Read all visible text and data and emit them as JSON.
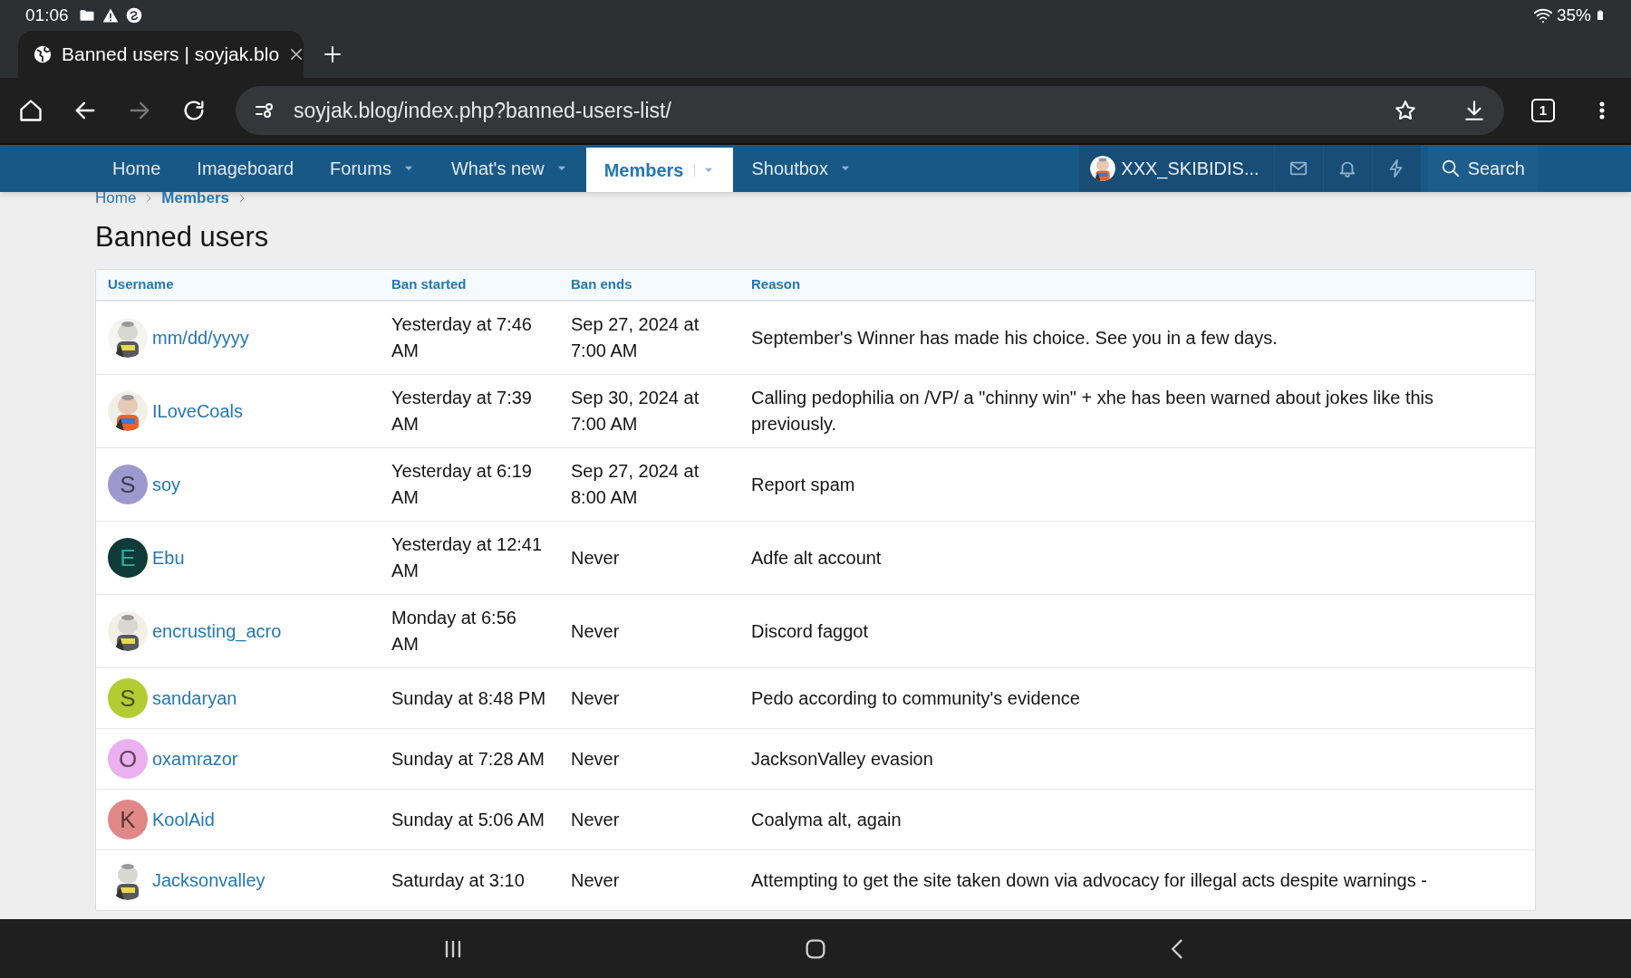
{
  "status_bar": {
    "time": "01:06",
    "battery": "35%"
  },
  "browser": {
    "tab_title": "Banned users | soyjak.blo",
    "url": "soyjak.blog/index.php?banned-users-list/",
    "tab_count": "1"
  },
  "nav": {
    "items": [
      {
        "label": "Home",
        "selected": false,
        "dropdown": false
      },
      {
        "label": "Imageboard",
        "selected": false,
        "dropdown": false
      },
      {
        "label": "Forums",
        "selected": false,
        "dropdown": true
      },
      {
        "label": "What's new",
        "selected": false,
        "dropdown": true
      },
      {
        "label": "Members",
        "selected": true,
        "dropdown": true
      },
      {
        "label": "Shoutbox",
        "selected": false,
        "dropdown": true
      }
    ],
    "user": "XXX_SKIBIDIS...",
    "search": "Search"
  },
  "breadcrumb": [
    "Home",
    "Members"
  ],
  "title": "Banned users",
  "table": {
    "columns": [
      "Username",
      "Ban started",
      "Ban ends",
      "Reason"
    ],
    "rows": [
      {
        "username": "mm/dd/yyyy",
        "ban_started": "Yesterday at 7:46 AM",
        "ban_ends": "Sep 27, 2024 at 7:00 AM",
        "reason": "September's Winner has made his choice. See you in a few days."
      },
      {
        "username": "ILoveCoals",
        "ban_started": "Yesterday at 7:39 AM",
        "ban_ends": "Sep 30, 2024 at 7:00 AM",
        "reason": "Calling pedophilia on /VP/ a \"chinny win\" + xhe has been warned about jokes like this previously."
      },
      {
        "avatar": {
          "kind": "letter",
          "letter": "S",
          "color": "#9d99cf"
        },
        "username": "soy",
        "ban_started": "Yesterday at 6:19 AM",
        "ban_ends": "Sep 27, 2024 at 8:00 AM",
        "reason": "Report spam"
      },
      {
        "avatar": {
          "kind": "letter",
          "letter": "E",
          "color": "#0e3a38"
        },
        "username": "Ebu",
        "ban_started": "Yesterday at 12:41 AM",
        "ban_ends": "Never",
        "reason": "Adfe alt account"
      },
      {
        "username": "encrusting_acro",
        "ban_started": "Monday at 6:56 AM",
        "ban_ends": "Never",
        "reason": "Discord faggot"
      },
      {
        "avatar": {
          "kind": "letter",
          "letter": "S",
          "color": "#b4cc33"
        },
        "username": "sandaryan",
        "ban_started": "Sunday at 8:48 PM",
        "ban_ends": "Never",
        "reason": "Pedo according to community's evidence"
      },
      {
        "avatar": {
          "kind": "letter",
          "letter": "O",
          "color": "#ebb0ef"
        },
        "username": "oxamrazor",
        "ban_started": "Sunday at 7:28 AM",
        "ban_ends": "Never",
        "reason": "JacksonValley evasion"
      },
      {
        "avatar": {
          "kind": "letter",
          "letter": "K",
          "color": "#e08787"
        },
        "username": "KoolAid",
        "ban_started": "Sunday at 5:06 AM",
        "ban_ends": "Never",
        "reason": "Coalyma alt, again"
      },
      {
        "username": "Jacksonvalley",
        "ban_started": "Saturday at 3:10",
        "ban_ends": "Never",
        "reason": "Attempting to get the site taken down via advocacy for illegal acts despite warnings -"
      }
    ]
  }
}
